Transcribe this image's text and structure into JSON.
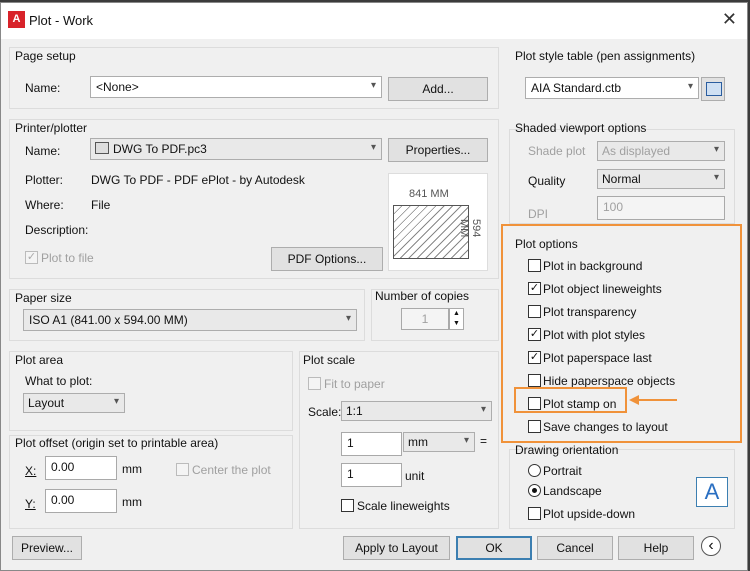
{
  "window": {
    "title": "Plot - Work",
    "close": "✕",
    "app_letter": "A"
  },
  "page_setup": {
    "header": "Page setup",
    "name_label": "Name:",
    "name_value": "<None>",
    "add_button": "Add..."
  },
  "printer": {
    "header": "Printer/plotter",
    "name_label": "Name:",
    "name_value": "DWG To PDF.pc3",
    "properties_button": "Properties...",
    "plotter_label": "Plotter:",
    "plotter_value": "DWG To PDF - PDF ePlot - by Autodesk",
    "where_label": "Where:",
    "where_value": "File",
    "description_label": "Description:",
    "plot_to_file_label": "Plot to file",
    "plot_to_file_checked": true,
    "pdf_options_button": "PDF Options...",
    "preview_width": "841 MM",
    "preview_height": "594 MM"
  },
  "paper_size": {
    "header": "Paper size",
    "value": "ISO A1 (841.00 x 594.00 MM)"
  },
  "copies": {
    "header": "Number of copies",
    "value": "1"
  },
  "plot_area": {
    "header": "Plot area",
    "what_label": "What to plot:",
    "value": "Layout"
  },
  "plot_scale": {
    "header": "Plot scale",
    "fit_label": "Fit to paper",
    "scale_label": "Scale:",
    "scale_value": "1:1",
    "value1": "1",
    "unit1": "mm",
    "equals": "=",
    "value2": "1",
    "unit2": "unit",
    "scale_lineweights": "Scale lineweights"
  },
  "plot_offset": {
    "header": "Plot offset (origin set to printable area)",
    "x_label": "X:",
    "x_value": "0.00",
    "x_unit": "mm",
    "y_label": "Y:",
    "y_value": "0.00",
    "y_unit": "mm",
    "center_label": "Center the plot"
  },
  "plot_style_table": {
    "header": "Plot style table (pen assignments)",
    "value": "AIA Standard.ctb"
  },
  "shaded": {
    "header": "Shaded viewport options",
    "shade_label": "Shade plot",
    "shade_value": "As displayed",
    "quality_label": "Quality",
    "quality_value": "Normal",
    "dpi_label": "DPI",
    "dpi_value": "100"
  },
  "plot_options": {
    "header": "Plot options",
    "items": [
      {
        "label": "Plot in background",
        "checked": false
      },
      {
        "label": "Plot object lineweights",
        "checked": true
      },
      {
        "label": "Plot transparency",
        "checked": false
      },
      {
        "label": "Plot with plot styles",
        "checked": true
      },
      {
        "label": "Plot paperspace last",
        "checked": true
      },
      {
        "label": "Hide paperspace objects",
        "checked": false
      },
      {
        "label": "Plot stamp on",
        "checked": false
      },
      {
        "label": "Save changes to layout",
        "checked": false
      }
    ]
  },
  "orientation": {
    "header": "Drawing orientation",
    "portrait": "Portrait",
    "landscape": "Landscape",
    "upside_down": "Plot upside-down",
    "selected": "Landscape",
    "icon_letter": "A"
  },
  "footer": {
    "preview": "Preview...",
    "apply": "Apply to Layout",
    "ok": "OK",
    "cancel": "Cancel",
    "help": "Help",
    "back_icon": "‹"
  },
  "colors": {
    "highlight": "#f0923a",
    "ok_border": "#3c7fb1"
  },
  "icons": [
    "close-icon",
    "printer-icon",
    "plot-style-edit-icon",
    "orientation-icon",
    "back-arrow-icon",
    "arrow-icon"
  ]
}
